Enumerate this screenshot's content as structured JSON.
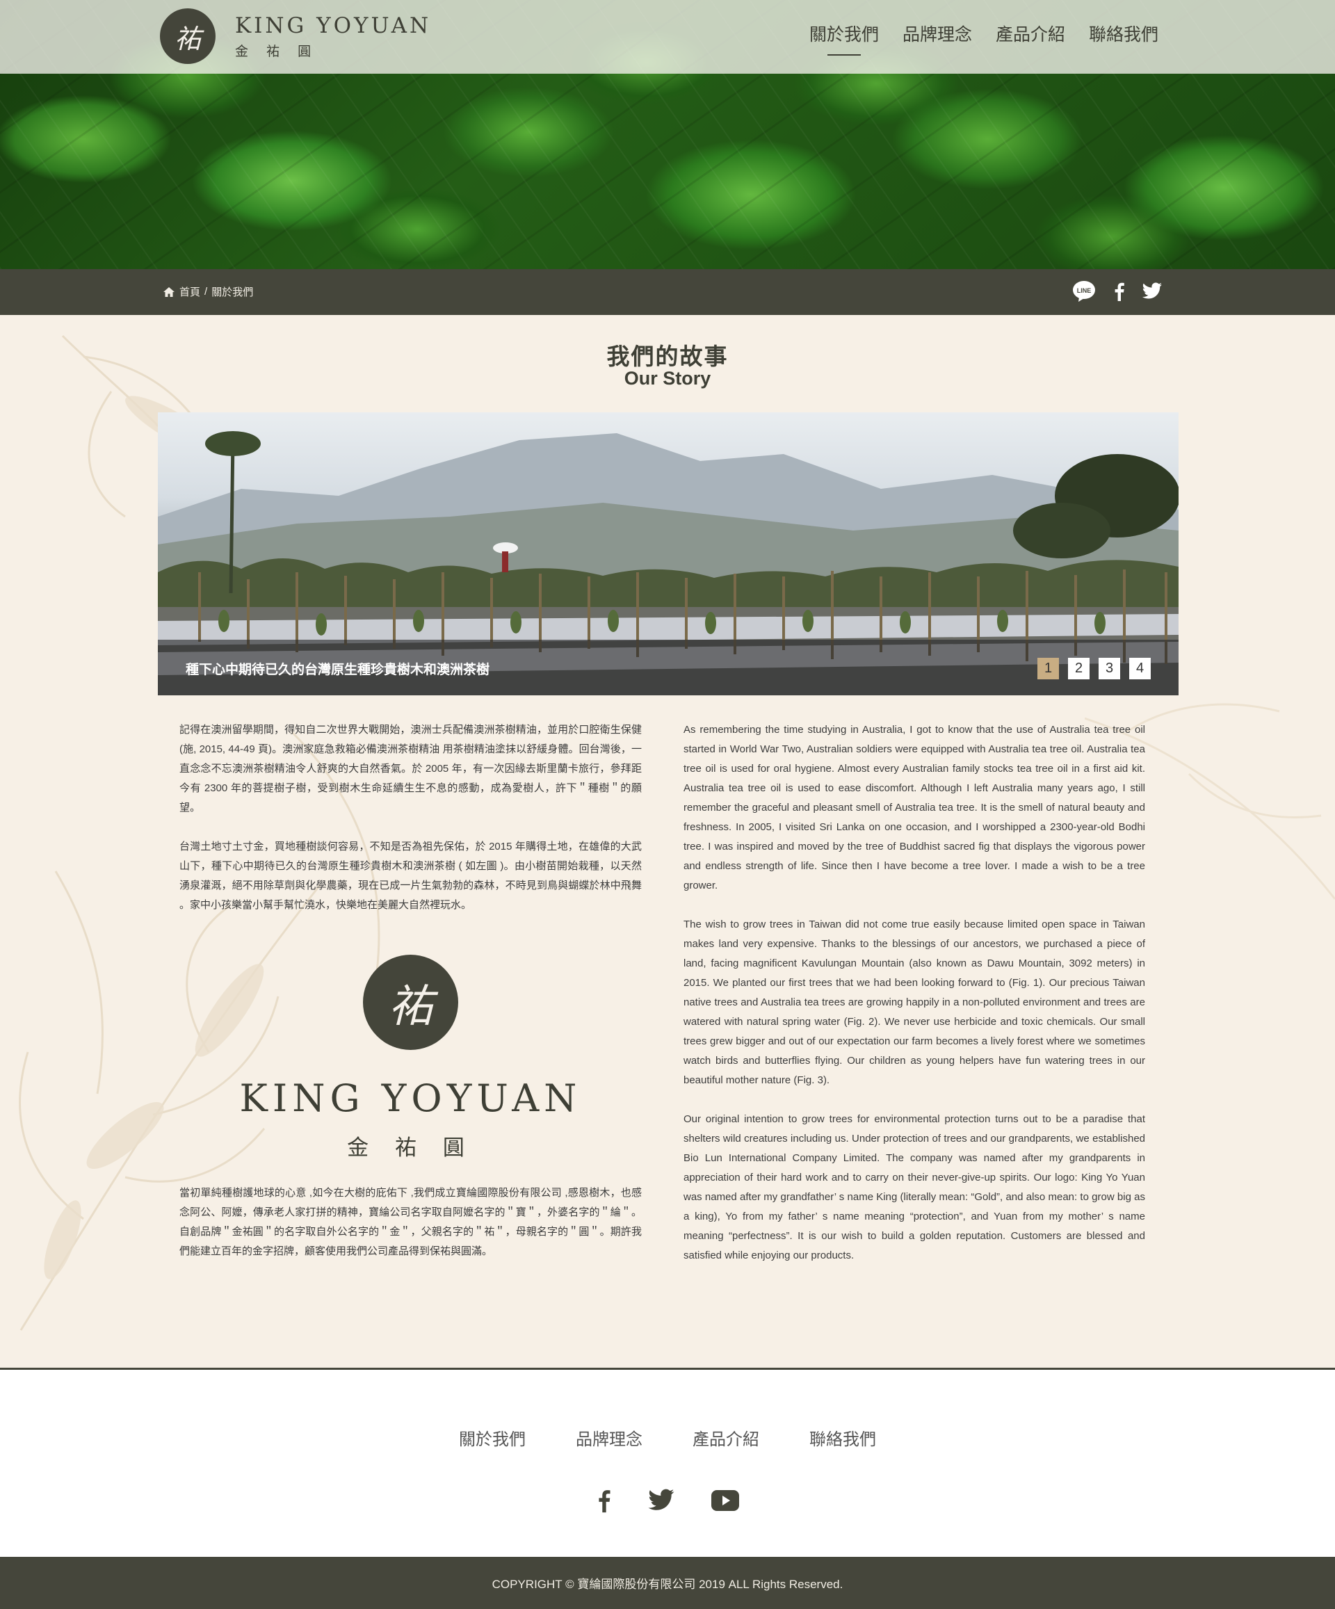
{
  "brand": {
    "name_en": "KING YOYUAN",
    "name_zh": "金 祐 圓",
    "mark": "祐"
  },
  "nav": {
    "items": [
      {
        "label": "關於我們",
        "active": true
      },
      {
        "label": "品牌理念",
        "active": false
      },
      {
        "label": "產品介紹",
        "active": false
      },
      {
        "label": "聯絡我們",
        "active": false
      }
    ]
  },
  "breadcrumb": {
    "home": "首頁",
    "separator": "/",
    "current": "關於我們"
  },
  "share": {
    "icons": [
      "line-icon",
      "facebook-icon",
      "twitter-icon"
    ],
    "line_text": "LINE"
  },
  "section": {
    "title_zh": "我們的故事",
    "title_en": "Our Story"
  },
  "slider": {
    "caption": "種下心中期待已久的台灣原生種珍貴樹木和澳洲茶樹",
    "pages": [
      "1",
      "2",
      "3",
      "4"
    ],
    "active_page": "1"
  },
  "story_zh": {
    "p1": "記得在澳洲留學期間，得知自二次世界大戰開始，澳洲士兵配備澳洲茶樹精油，並用於口腔衛生保健 (施, 2015, 44-49 頁)。澳洲家庭急救箱必備澳洲茶樹精油 用茶樹精油塗抹以舒緩身體。回台灣後，一直念念不忘澳洲茶樹精油令人舒爽的大自然香氣。於 2005 年，有一次因緣去斯里蘭卡旅行，參拜距今有 2300 年的菩提樹子樹，受到樹木生命延續生生不息的感動，成為愛樹人，許下＂種樹＂的願望。",
    "p2": "台灣土地寸土寸金，買地種樹談何容易，不知是否為祖先保佑，於 2015 年購得土地，在雄偉的大武山下，種下心中期待已久的台灣原生種珍貴樹木和澳洲茶樹 ( 如左圖 )。由小樹苗開始栽種，以天然湧泉灌溉，絕不用除草劑與化學農藥，現在已成一片生氣勃勃的森林，不時見到鳥與蝴蝶於林中飛舞 。家中小孩樂當小幫手幫忙澆水，快樂地在美麗大自然裡玩水。",
    "p3": "當初單純種樹護地球的心意 ,如今在大樹的庇佑下 ,我們成立寶綸國際股份有限公司 ,感恩樹木，也感念阿公、阿嬤，傳承老人家打拼的精神，寶綸公司名字取自阿嬤名字的＂寶＂，外婆名字的＂綸＂。自創品牌＂金祐圓＂的名字取自外公名字的＂金＂，父親名字的＂祐＂，母親名字的＂圓＂。期許我們能建立百年的金字招牌，顧客使用我們公司產品得到保祐與圓滿。"
  },
  "story_en": {
    "p1": "As remembering the time studying in Australia, I got to know that the use of Australia tea tree oil started in World War Two, Australian soldiers were equipped with Australia tea tree oil. Australia tea tree oil is used for oral hygiene. Almost every Australian family stocks tea tree oil in a first aid kit. Australia tea tree oil is used to ease discomfort. Although I left Australia many years ago, I still remember the graceful and pleasant smell of Australia tea tree. It is the smell of natural beauty and freshness. In 2005, I visited Sri Lanka on one occasion, and I worshipped a 2300-year-old Bodhi tree. I was inspired and moved by the tree of Buddhist sacred fig that displays the vigorous power and endless strength of life. Since then I have become a tree lover. I made a wish to be a tree grower.",
    "p2": "The wish to grow trees in Taiwan did not come true easily because limited open space in Taiwan makes land very expensive. Thanks to the blessings of our ancestors, we purchased a piece of land, facing magnificent Kavulungan Mountain (also known as Dawu Mountain, 3092 meters) in 2015. We planted our first trees that we had been looking forward to (Fig. 1). Our precious Taiwan native trees and Australia tea trees are growing happily in a non-polluted environment and trees are watered with natural spring water (Fig. 2). We never use herbicide and toxic chemicals. Our small trees grew bigger and out of our expectation our farm becomes a lively forest where we sometimes watch birds and butterflies flying. Our children as young helpers have fun watering trees in our beautiful mother nature (Fig. 3).",
    "p3": "Our original intention to grow trees for environmental protection turns out to be a paradise that shelters wild creatures including us. Under protection of trees and our grandparents, we established Bio Lun International Company Limited. The company was named after my grandparents in appreciation of their hard work and to carry on their never-give-up spirits. Our logo: King Yo Yuan was named after my grandfather’ s name King (literally mean: “Gold”, and also mean: to grow big as a king), Yo from my father’ s name meaning “protection”, and Yuan from my mother’ s name meaning “perfectness”. It is our wish to build a golden reputation. Customers are blessed and satisfied while enjoying our products."
  },
  "footer": {
    "nav": [
      "關於我們",
      "品牌理念",
      "產品介紹",
      "聯絡我們"
    ],
    "social": [
      "facebook-icon",
      "twitter-icon",
      "youtube-icon"
    ],
    "copyright": "COPYRIGHT © 寶綸國際股份有限公司 2019 ALL Rights Reserved."
  },
  "colors": {
    "dark_olive": "#45463b",
    "cream": "#f7f0e6",
    "gold_accent": "#c8ad83"
  }
}
